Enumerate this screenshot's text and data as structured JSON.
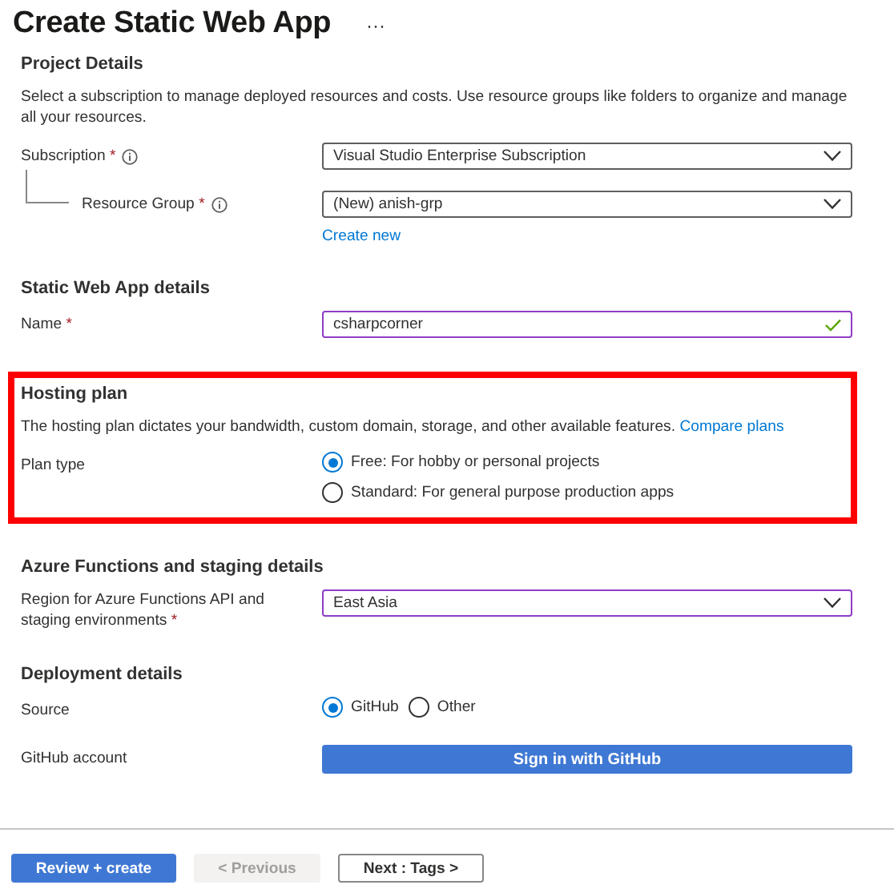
{
  "header": {
    "title": "Create Static Web App",
    "more": "···"
  },
  "sections": [
    {
      "heading": "Project Details",
      "description": "Select a subscription to manage deployed resources and costs. Use resource groups like folders to organize and manage all your resources.",
      "rows": [
        {
          "label": "Subscription",
          "required_mark": "*",
          "info": true,
          "kind": "select",
          "value": "Visual Studio Enterprise Subscription",
          "children": [
            {
              "label": "Resource Group",
              "required_mark": "*",
              "info": true,
              "kind": "select",
              "value": "(New) anish-grp",
              "link": "Create new"
            }
          ]
        }
      ]
    },
    {
      "heading": "Static Web App details",
      "rows": [
        {
          "label": "Name",
          "required_mark": "*",
          "kind": "text",
          "value": "csharpcorner",
          "active": true,
          "valid": true
        }
      ]
    },
    {
      "heading": "Hosting plan",
      "highlighted": true,
      "description": "The hosting plan dictates your bandwidth, custom domain, storage, and other available features.",
      "description_link": "Compare plans",
      "rows": [
        {
          "label": "Plan type",
          "kind": "radio-list",
          "options": [
            {
              "label": "Free: For hobby or personal projects",
              "selected": true
            },
            {
              "label": "Standard: For general purpose production apps",
              "selected": false
            }
          ]
        }
      ]
    },
    {
      "heading": "Azure Functions and staging details",
      "rows": [
        {
          "label": "Region for Azure Functions API and staging environments",
          "required_mark": "*",
          "kind": "select",
          "value": "East Asia",
          "active": true
        }
      ]
    },
    {
      "heading": "Deployment details",
      "rows": [
        {
          "label": "Source",
          "kind": "radio-inline",
          "options": [
            {
              "label": "GitHub",
              "selected": true
            },
            {
              "label": "Other",
              "selected": false
            }
          ]
        },
        {
          "label": "GitHub account",
          "kind": "button",
          "value": "Sign in with GitHub"
        }
      ]
    }
  ],
  "footer": {
    "buttons": [
      {
        "label": "Review + create",
        "kind": "primary",
        "disabled": false
      },
      {
        "label": "< Previous",
        "kind": "secondary",
        "disabled": true
      },
      {
        "label": "Next : Tags >",
        "kind": "secondary",
        "disabled": false
      }
    ]
  }
}
